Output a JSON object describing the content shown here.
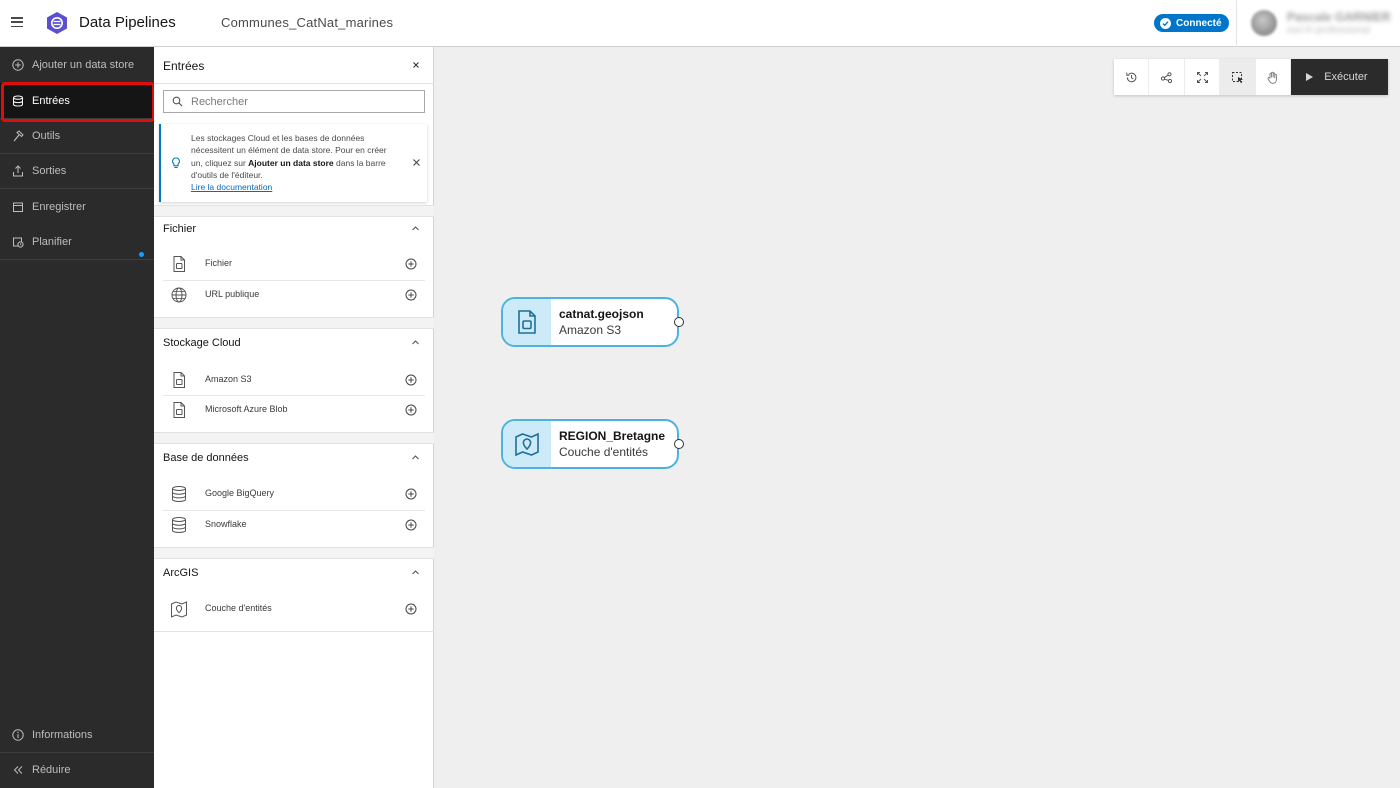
{
  "header": {
    "app_title": "Data Pipelines",
    "document_title": "Communes_CatNat_marines",
    "status": "Connecté",
    "user_name": "Pascale GARNIER",
    "user_org": "esri-fr-professional"
  },
  "leftnav": {
    "items": [
      {
        "label": "Ajouter un data store",
        "icon": "plus-circle-icon"
      },
      {
        "label": "Entrées",
        "icon": "database-icon",
        "active": true
      },
      {
        "label": "Outils",
        "icon": "hammer-icon"
      },
      {
        "label": "Sorties",
        "icon": "export-icon"
      },
      {
        "label": "Enregistrer",
        "icon": "save-icon",
        "unsaved_indicator": true
      },
      {
        "label": "Planifier",
        "icon": "calendar-clock-icon"
      }
    ],
    "footer": [
      {
        "label": "Informations",
        "icon": "info-icon"
      },
      {
        "label": "Réduire",
        "icon": "collapse-icon"
      }
    ]
  },
  "panel": {
    "title": "Entrées",
    "search_placeholder": "Rechercher",
    "notice": {
      "text_before": "Les stockages Cloud et les bases de données nécessitent un élément de data store. Pour en créer un, cliquez sur ",
      "bold": "Ajouter un data store",
      "text_after": " dans la barre d'outils de l'éditeur.",
      "link": "Lire la documentation"
    },
    "sections": [
      {
        "title": "Fichier",
        "items": [
          "Fichier",
          "URL publique"
        ]
      },
      {
        "title": "Stockage Cloud",
        "items": [
          "Amazon S3",
          "Microsoft Azure Blob"
        ]
      },
      {
        "title": "Base de données",
        "items": [
          "Google BigQuery",
          "Snowflake"
        ]
      },
      {
        "title": "ArcGIS",
        "items": [
          "Couche d'entités"
        ]
      }
    ]
  },
  "toolbar": {
    "tools": [
      "history-icon",
      "share-nodes-icon",
      "fit-view-icon",
      "select-icon",
      "pan-hand-icon"
    ],
    "run_label": "Exécuter"
  },
  "nodes": [
    {
      "title": "catnat.geojson",
      "subtitle": "Amazon S3",
      "icon": "file-icon"
    },
    {
      "title": "REGION_Bretagne",
      "subtitle": "Couche d'entités",
      "icon": "map-pin-icon"
    }
  ],
  "colors": {
    "accent": "#0075c9",
    "node_border": "#4cb3e0",
    "node_icon_bg": "#cdeaf8",
    "nav_bg": "#2b2b2b",
    "highlight": "#e00d0d"
  }
}
